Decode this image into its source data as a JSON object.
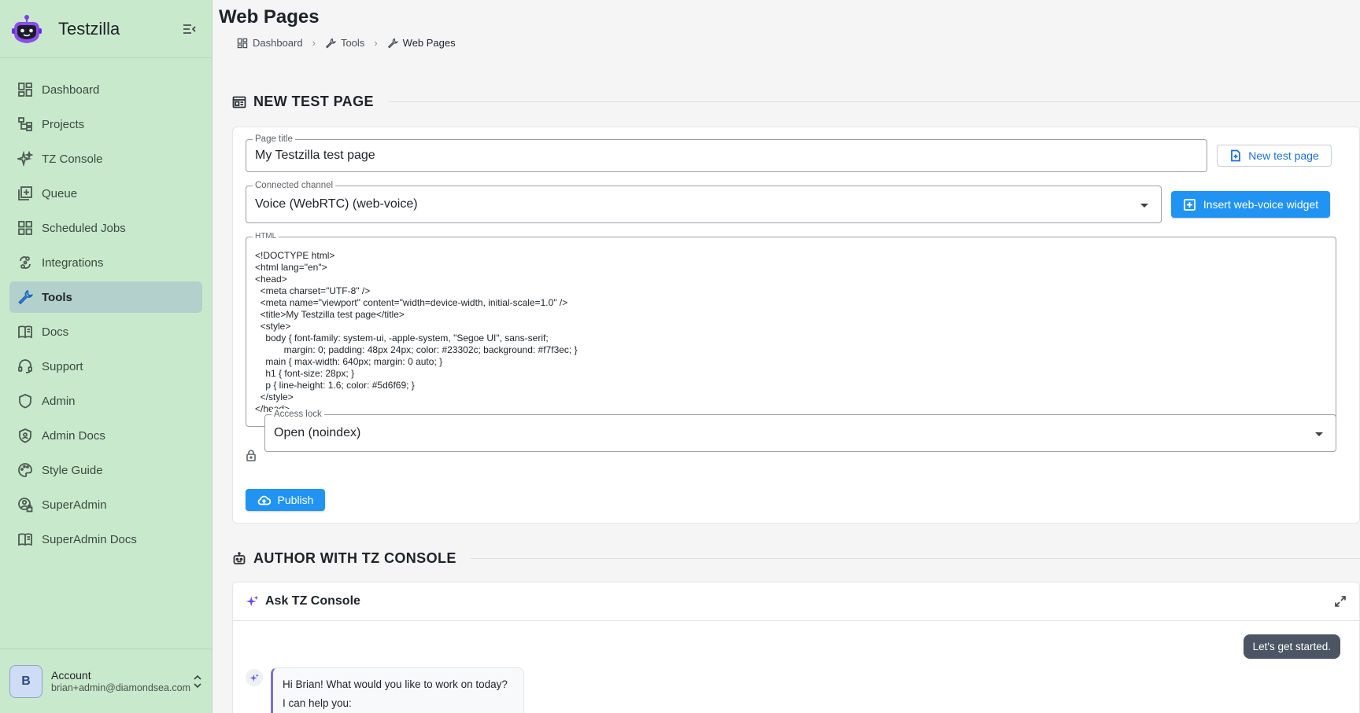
{
  "app": {
    "name": "Testzilla"
  },
  "sidebar": {
    "items": [
      {
        "label": "Dashboard",
        "icon": "dashboard-icon"
      },
      {
        "label": "Projects",
        "icon": "projects-icon"
      },
      {
        "label": "TZ Console",
        "icon": "sparkle-icon"
      },
      {
        "label": "Queue",
        "icon": "queue-icon"
      },
      {
        "label": "Scheduled Jobs",
        "icon": "grid-icon"
      },
      {
        "label": "Integrations",
        "icon": "integrations-icon"
      },
      {
        "label": "Tools",
        "icon": "wrench-icon",
        "active": true
      },
      {
        "label": "Docs",
        "icon": "book-icon"
      },
      {
        "label": "Support",
        "icon": "support-icon"
      },
      {
        "label": "Admin",
        "icon": "shield-icon"
      },
      {
        "label": "Admin Docs",
        "icon": "shield-check-icon"
      },
      {
        "label": "Style Guide",
        "icon": "palette-icon"
      },
      {
        "label": "SuperAdmin",
        "icon": "lock-person-icon"
      },
      {
        "label": "SuperAdmin Docs",
        "icon": "book-icon"
      }
    ],
    "account": {
      "initial": "B",
      "label": "Account",
      "email": "brian+admin@diamondsea.com"
    }
  },
  "page": {
    "title": "Web Pages",
    "breadcrumb": [
      "Dashboard",
      "Tools",
      "Web Pages"
    ]
  },
  "new_test_page": {
    "heading": "NEW TEST PAGE",
    "page_title_label": "Page title",
    "page_title_value": "My Testzilla test page",
    "new_button": "New test page",
    "channel_label": "Connected channel",
    "channel_value": "Voice (WebRTC)  (web-voice)",
    "insert_button": "Insert web-voice widget",
    "html_label": "HTML",
    "html_value": "<!DOCTYPE html>\n<html lang=\"en\">\n<head>\n  <meta charset=\"UTF-8\" />\n  <meta name=\"viewport\" content=\"width=device-width, initial-scale=1.0\" />\n  <title>My Testzilla test page</title>\n  <style>\n    body { font-family: system-ui, -apple-system, \"Segoe UI\", sans-serif;\n           margin: 0; padding: 48px 24px; color: #23302c; background: #f7f3ec; }\n    main { max-width: 640px; margin: 0 auto; }\n    h1 { font-size: 28px; }\n    p { line-height: 1.6; color: #5d6f69; }\n  </style>\n</head>",
    "access_label": "Access lock",
    "access_value": "Open (noindex)",
    "publish_button": "Publish"
  },
  "console": {
    "heading": "AUTHOR WITH TZ CONSOLE",
    "title": "Ask TZ Console",
    "user_message": "Let's get started.",
    "bot_line1": "Hi Brian! What would you like to work on today?",
    "bot_line2": "I can help you:"
  },
  "colors": {
    "sidebar_bg": "#c9e9cc",
    "primary": "#2194f3",
    "active_item": "#b3d0cc"
  }
}
